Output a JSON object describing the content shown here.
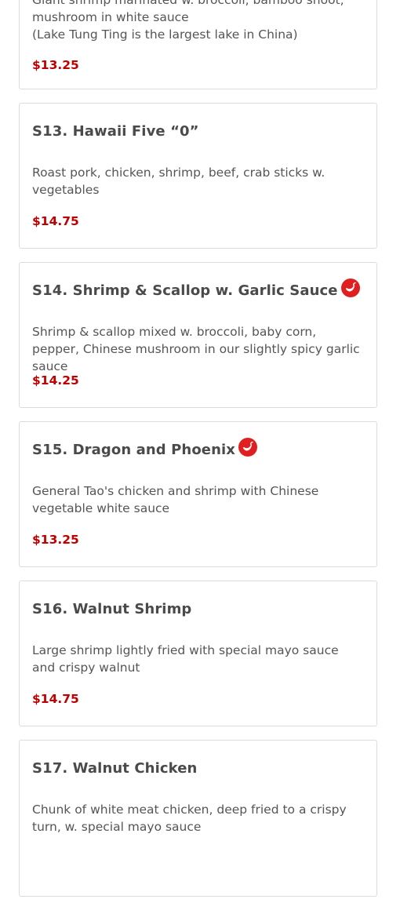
{
  "menu": {
    "items": [
      {
        "code_title": "",
        "description": "Giant shrimp marinated w. broccoli, bamboo shoot, mushroom in white sauce\n(Lake Tung Ting is the largest lake in China)",
        "description_line1": "Giant shrimp marinated w. broccoli, bamboo shoot,",
        "description_line2": "mushroom in white sauce",
        "description_line3": "(Lake Tung Ting is the largest lake in China)",
        "price": "$13.25",
        "spicy": false
      },
      {
        "code_title": "S13. Hawaii Five “0”",
        "description": "Roast pork, chicken, shrimp, beef, crab sticks w. vegetables",
        "price": "$14.75",
        "spicy": false
      },
      {
        "code_title": "S14. Shrimp & Scallop w. Garlic Sauce",
        "description": "Shrimp & scallop mixed w. broccoli, baby corn, pepper, Chinese mushroom in our slightly spicy garlic sauce",
        "price": "$14.25",
        "spicy": true
      },
      {
        "code_title": "S15. Dragon and Phoenix",
        "description": "General Tao's chicken and shrimp with Chinese vegetable white sauce",
        "price": "$13.25",
        "spicy": true
      },
      {
        "code_title": "S16. Walnut Shrimp",
        "description": "Large shrimp lightly fried with special mayo sauce and crispy walnut",
        "price": "$14.75",
        "spicy": false
      },
      {
        "code_title": "S17. Walnut Chicken",
        "description": "Chunk of white meat chicken, deep fried to a crispy turn, w. special mayo sauce",
        "price": "",
        "spicy": false
      }
    ]
  },
  "icons": {
    "spicy": "chili-pepper-icon"
  },
  "colors": {
    "price": "#c00000",
    "spicy_icon": "#e02020",
    "title": "#4a4a4a",
    "description": "#555555",
    "card_border": "#dcdcdc"
  }
}
